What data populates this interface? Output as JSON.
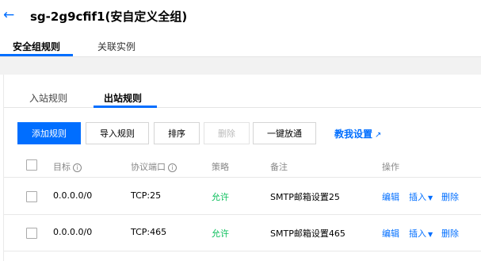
{
  "header": {
    "back_icon": "arrow-left-icon",
    "title": "sg-2g9cfif1(安自定义全组)"
  },
  "top_tabs": [
    {
      "label": "安全组规则",
      "active": true
    },
    {
      "label": "关联实例",
      "active": false
    }
  ],
  "sub_tabs": [
    {
      "label": "入站规则",
      "active": false
    },
    {
      "label": "出站规则",
      "active": true
    }
  ],
  "toolbar": {
    "add_label": "添加规则",
    "import_label": "导入规则",
    "sort_label": "排序",
    "delete_label": "删除",
    "one_click_label": "一键放通",
    "help_label": "教我设置",
    "help_icon": "external-link-icon"
  },
  "table": {
    "columns": [
      "目标",
      "协议端口",
      "策略",
      "备注",
      "操作"
    ],
    "rows": [
      {
        "target": "0.0.0.0/0",
        "port": "TCP:25",
        "policy": "允许",
        "remark": "SMTP邮箱设置25",
        "edit": "编辑",
        "insert": "插入",
        "delete": "删除"
      },
      {
        "target": "0.0.0.0/0",
        "port": "TCP:465",
        "policy": "允许",
        "remark": "SMTP邮箱设置465",
        "edit": "编辑",
        "insert": "插入",
        "delete": "删除"
      }
    ]
  },
  "colors": {
    "accent": "#006eff",
    "allow": "#0abf5b"
  }
}
